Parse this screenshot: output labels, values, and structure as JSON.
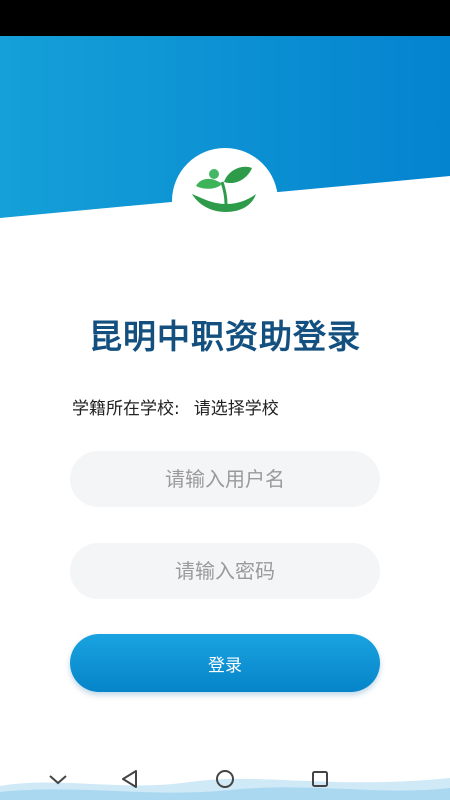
{
  "app": {
    "title": "昆明中职资助登录"
  },
  "school": {
    "label": "学籍所在学校:",
    "value": "请选择学校"
  },
  "form": {
    "username_placeholder": "请输入用户名",
    "password_placeholder": "请输入密码",
    "login_label": "登录"
  },
  "colors": {
    "header_blue": "#0a8fd5",
    "title": "#14507f",
    "button": "#0b8fd2",
    "logo_green": "#2e9b4a"
  },
  "nav_icons": [
    "chevron-down-icon",
    "back-triangle-icon",
    "home-circle-icon",
    "recent-square-icon"
  ]
}
